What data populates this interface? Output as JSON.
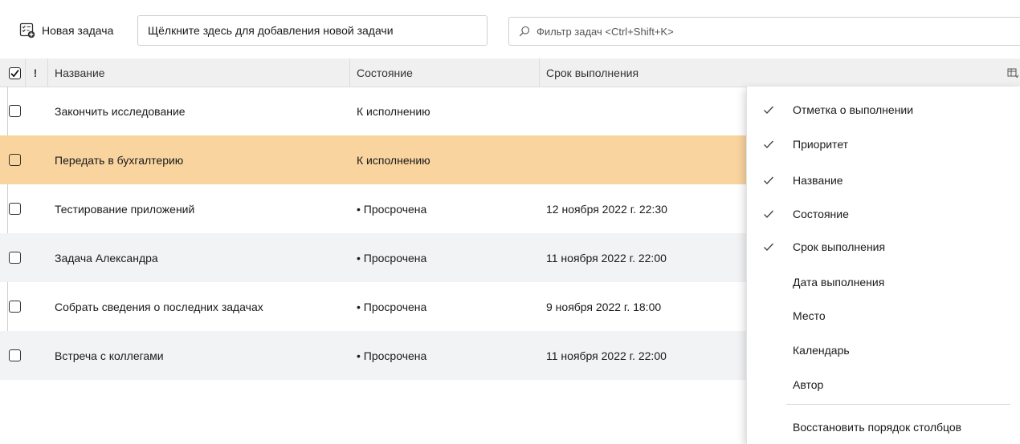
{
  "toolbar": {
    "new_task_label": "Новая задача",
    "quick_add_value": "Щёлкните здесь для добавления новой задачи",
    "filter_placeholder": "Фильтр задач <Ctrl+Shift+K>"
  },
  "columns": {
    "priority_label": "!",
    "title": "Название",
    "status": "Состояние",
    "due": "Срок выполнения"
  },
  "tasks": [
    {
      "title": "Закончить исследование",
      "status": "К исполнению",
      "due": ""
    },
    {
      "title": "Передать в бухгалтерию",
      "status": "К исполнению",
      "due": ""
    },
    {
      "title": "Тестирование приложений",
      "status": "• Просрочена",
      "due": "12 ноября 2022 г. 22:30"
    },
    {
      "title": "Задача Александра",
      "status": "• Просрочена",
      "due": "11 ноября 2022 г. 22:00"
    },
    {
      "title": "Собрать сведения о последних задачах",
      "status": "• Просрочена",
      "due": "9 ноября 2022 г. 18:00"
    },
    {
      "title": "Встреча с коллегами",
      "status": "• Просрочена",
      "due": "11 ноября 2022 г. 22:00"
    }
  ],
  "selected_task": "Передать в бухгалтерию",
  "column_menu": {
    "items": [
      {
        "label": "Отметка о выполнении",
        "checked": true
      },
      {
        "label": "Приоритет",
        "checked": true
      },
      {
        "label": "Название",
        "checked": true
      },
      {
        "label": "Состояние",
        "checked": true
      },
      {
        "label": "Срок выполнения",
        "checked": true
      },
      {
        "label": "Дата выполнения",
        "checked": false
      },
      {
        "label": "Место",
        "checked": false
      },
      {
        "label": "Календарь",
        "checked": false
      },
      {
        "label": "Автор",
        "checked": false
      }
    ],
    "restore_label": "Восстановить порядок столбцов"
  },
  "colors": {
    "selected_row": "#f9d49f",
    "alt_row": "#f2f3f5",
    "header_bg": "#f0f0f0"
  },
  "icons": {
    "new_task": "task-add-icon",
    "filter": "search-icon",
    "column_picker": "column-picker-icon",
    "check": "check-icon"
  }
}
